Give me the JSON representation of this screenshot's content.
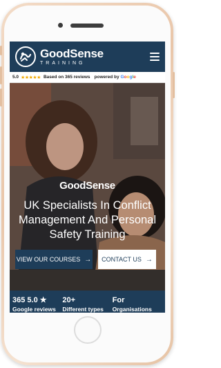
{
  "header": {
    "brand_name": "GoodSense",
    "brand_sub": "TRAINING",
    "brand_color": "#1e3d59"
  },
  "reviews": {
    "score": "5.0",
    "stars": "★★★★★",
    "based_on": "Based on 365 reviews",
    "powered_by": "powered by",
    "google": [
      "G",
      "o",
      "o",
      "g",
      "l",
      "e"
    ]
  },
  "hero": {
    "brand": "GoodSense",
    "title": "UK Specialists In Conflict Management And Personal Safety Training",
    "courses_button": "VIEW OUR COURSES",
    "contact_button": "CONTACT US",
    "arrow": "→"
  },
  "stats": [
    {
      "main": "365 5.0 ★",
      "sub": "Google reviews"
    },
    {
      "main": "20+",
      "sub": "Different types"
    },
    {
      "main": "For",
      "sub": "Organisations"
    }
  ]
}
